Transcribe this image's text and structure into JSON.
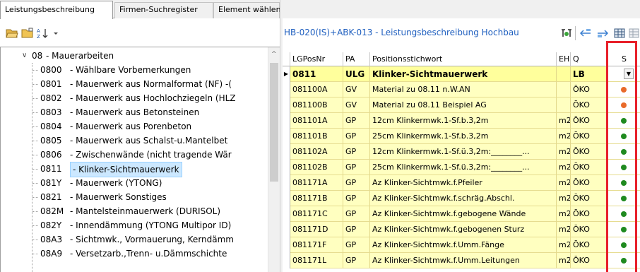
{
  "tabs": [
    {
      "label": "Leistungsbeschreibung",
      "active": true
    },
    {
      "label": "Firmen-Suchregister",
      "active": false
    },
    {
      "label": "Element wählen",
      "active": false
    }
  ],
  "left_toolbar": {
    "icons": [
      "open-folder-icon",
      "folder-icon",
      "sort-az-icon",
      "dropdown-arrow-icon"
    ]
  },
  "tree": {
    "parent": {
      "code": "08",
      "label": "- Mauerarbeiten"
    },
    "items": [
      {
        "code": "0800",
        "label": "- Wählbare Vorbemerkungen"
      },
      {
        "code": "0801",
        "label": "- Mauerwerk aus Normalformat (NF) -("
      },
      {
        "code": "0802",
        "label": "- Mauerwerk aus Hochlochziegeln (HLZ"
      },
      {
        "code": "0803",
        "label": "- Mauerwerk aus Betonsteinen"
      },
      {
        "code": "0804",
        "label": "- Mauerwerk aus Porenbeton"
      },
      {
        "code": "0805",
        "label": "- Mauerwerk aus Schalst-u.Mantelbet"
      },
      {
        "code": "0806",
        "label": "- Zwischenwände (nicht tragende Wär"
      },
      {
        "code": "0811",
        "label": "- Klinker-Sichtmauerwerk",
        "selected": true
      },
      {
        "code": "081Y",
        "label": "- Mauerwerk (YTONG)"
      },
      {
        "code": "0821",
        "label": "- Mauerwerk Sonstiges"
      },
      {
        "code": "082M",
        "label": "- Mantelsteinmauerwerk (DURISOL)"
      },
      {
        "code": "082Y",
        "label": "- Innendämmung (YTONG Multipor ID)"
      },
      {
        "code": "08A3",
        "label": "- Sichtmwk., Vormauerung, Kerndämm"
      },
      {
        "code": "08A9",
        "label": "- Versetzarb.,Trenn- u.Dämmschichte"
      }
    ]
  },
  "right_toolbar": {
    "title": "HB-020(IS)+ABK-013 - Leistungsbeschreibung Hochbau",
    "icons": [
      "filter-icon",
      "move-left-icon",
      "move-right-icon",
      "grid-icon",
      "grid-disabled-icon"
    ]
  },
  "grid": {
    "columns": [
      "LGPosNr",
      "PA",
      "Positionsstichwort",
      "EH",
      "Q",
      "S"
    ],
    "rows": [
      {
        "nr": "0811",
        "pa": "ULG",
        "text": "Klinker-Sichtmauerwerk",
        "eh": "",
        "q": "LB",
        "s": "",
        "selected": true
      },
      {
        "nr": "081100A",
        "pa": "GV",
        "text": "Material zu 08.11 n.W.AN",
        "eh": "",
        "q": "ÖKO",
        "s": "orange"
      },
      {
        "nr": "081100B",
        "pa": "GV",
        "text": "Material zu 08.11 Beispiel AG",
        "eh": "",
        "q": "ÖKO",
        "s": "orange"
      },
      {
        "nr": "081101A",
        "pa": "GP",
        "text": "12cm Klinkermwk.1-Sf.b.3,2m",
        "eh": "m2",
        "q": "ÖKO",
        "s": "green"
      },
      {
        "nr": "081101B",
        "pa": "GP",
        "text": "25cm Klinkermwk.1-Sf.b.3,2m",
        "eh": "m2",
        "q": "ÖKO",
        "s": "green"
      },
      {
        "nr": "081102A",
        "pa": "GP",
        "text": "12cm Klinkermwk.1-Sf.ü.3,2m:________...",
        "eh": "m2",
        "q": "ÖKO",
        "s": "green"
      },
      {
        "nr": "081102B",
        "pa": "GP",
        "text": "25cm Klinkermwk.1-Sf.ü.3,2m:________...",
        "eh": "m2",
        "q": "ÖKO",
        "s": "green"
      },
      {
        "nr": "081171A",
        "pa": "GP",
        "text": "Az Klinker-Sichtmwk.f.Pfeiler",
        "eh": "m2",
        "q": "ÖKO",
        "s": "green"
      },
      {
        "nr": "081171B",
        "pa": "GP",
        "text": "Az Klinker-Sichtmwk.f.schräg.Abschl.",
        "eh": "m2",
        "q": "ÖKO",
        "s": "green"
      },
      {
        "nr": "081171C",
        "pa": "GP",
        "text": "Az Klinker-Sichtmwk.f.gebogene Wände",
        "eh": "m2",
        "q": "ÖKO",
        "s": "green"
      },
      {
        "nr": "081171D",
        "pa": "GP",
        "text": "Az Klinker-Sichtmwk.f.gebogenen Sturz",
        "eh": "m2",
        "q": "ÖKO",
        "s": "green"
      },
      {
        "nr": "081171F",
        "pa": "GP",
        "text": "Az Klinker-Sichtmwk.f.Umm.Fänge",
        "eh": "m2",
        "q": "ÖKO",
        "s": "green"
      },
      {
        "nr": "081171L",
        "pa": "GP",
        "text": "Az Klinker-Sichtmwk.f.Umm.Leitungen",
        "eh": "m2",
        "q": "ÖKO",
        "s": "green"
      }
    ]
  },
  "colors": {
    "row_bg": "#ffffc0",
    "selected_row_bg": "#ffff9c",
    "green": "#1f8a1f",
    "orange": "#e86a2a",
    "highlight_box": "#e8202a",
    "title_blue": "#1f5fbf"
  }
}
